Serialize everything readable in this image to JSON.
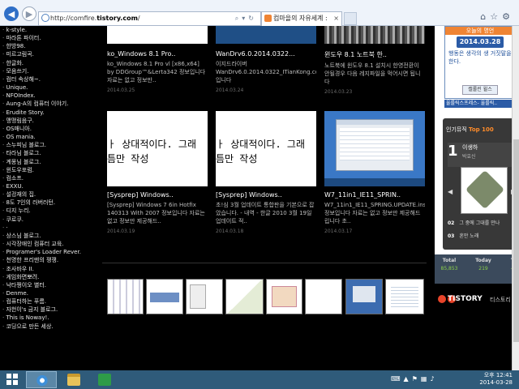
{
  "browser": {
    "url_prefix": "http://comfire.",
    "url_domain": "tistory.com",
    "url_suffix": "/",
    "tab_title": "컴마을의 자유세계 :",
    "tab_close": "×"
  },
  "sidebar": {
    "items": [
      "k-style.",
      "마라톤 파이터.",
      "한방98.",
      "미르고림곡.",
      "한글화.",
      "모음쓰기.",
      "컴터 속상해~.",
      "Unique.",
      "NFOIndex.",
      "Aung-A의 컴퓨터 이야기.",
      "Erudite Story.",
      "맹맹림음구.",
      "OS매니아.",
      "OS mania.",
      "스누피님 블로그.",
      "타라님 블로그.",
      "계몽님 블로그.",
      "윈도우포럼.",
      "컴소프.",
      "EXXU.",
      "설겅재의 집.",
      "8도 7인의 러버러턴.",
      "디지 누리.",
      "쿠로쿠.",
      "·",
      "상스님 블로그.",
      "시각장애인 컴퓨터 교육.",
      "Programer's Loader Rever.",
      "천명한 프리맨의 쟁쟁.",
      "조사바우 II.",
      "게임화면뽀려.",
      "낙타쩡이오 별터.",
      "Denme.",
      "컴퓨터하는 푸름.",
      "자헌이's 금지 블로그.",
      "This is Noway!.",
      "코딩으로 만든 세상."
    ]
  },
  "posts": {
    "top": [
      {
        "title": "ko_Windows 8.1 Pro..",
        "desc": "ko_Windows 8.1 Pro vl [x86,x64] by DDGroup™&Lerta342 정보입니다 자료는 없고 정보만..",
        "date": "2014.03.25"
      },
      {
        "title": "WanDrv6.0.2014.0322...",
        "desc": "이지드라이버 WanDrv6.0.2014.0322_ITianKong.com입니다 http://pan.baidu.com/s/1i3Tp...",
        "date": "2014.03.24"
      },
      {
        "title": "윈도우 8.1 노트북 한..",
        "desc": "노트북에 윈도우 8.1 설치시 한영전환이 안될경우 다음 레지파일을 먹어시면 됩니다",
        "date": "2014.03.23"
      }
    ],
    "bottom": [
      {
        "img_text_1": "ㅏ 상대적이다. 그래",
        "img_text_2": "틈만 작성",
        "title": "[Sysprep] Windows..",
        "desc": "[Sysprep] Windows 7 6in Hotfix 140313 With 2007 정보입니다 자료는 없고 정보만 제공해드..",
        "date": "2014.03.19"
      },
      {
        "img_text_1": "ㅏ 상대적이다. 그래",
        "img_text_2": "틈만 작성",
        "title": "[Sysprep] Windows..",
        "desc": "초!심 3월 업데이트 통합판을 기본으로 잡았습니다. - 내역 - 한글 2010 3월 19일 업데이트 적..",
        "date": "2014.03.18"
      },
      {
        "title": "W7_11in1_IE11_SPRIN..",
        "desc": "W7_11in1_IE11_SPRING.UPDATE.install 정보입니다 자료는 없고 정보만 제공해드립니다 초..",
        "date": "2014.03.17"
      }
    ]
  },
  "calendar": {
    "header": "오늘의 명언",
    "date": "2014.03.28",
    "text": "행동은 생각의 생 거짓말을 한다.",
    "button": "캘롤린 윌스",
    "banner": "울룰릭스프레스- 울룰릭.."
  },
  "top100": {
    "title_prefix": "인기뮤직",
    "title_highlight": "Top 100",
    "rank1_num": "1",
    "rank1_artist": "이생하",
    "rank1_song": "박효신",
    "prev": "◀",
    "next": "▶",
    "rank2_num": "02",
    "rank2_text": "그 중에 그대를 만나",
    "rank3_num": "03",
    "rank3_text": "혼만 노래"
  },
  "stats": {
    "total_label": "Total",
    "total_value": "85,853",
    "today_label": "Today",
    "today_value": "219",
    "yesterday_label": "Y",
    "yesterday_value": "4"
  },
  "tistory": {
    "logo": "TISTORY",
    "sub": "티스토리"
  },
  "taskbar": {
    "time": "오후 12:41",
    "date": "2014-03-28"
  },
  "colors": {
    "accent_orange": "#ef8434",
    "accent_blue": "#2b5ba6",
    "taskbar": "#2f5b7a"
  }
}
